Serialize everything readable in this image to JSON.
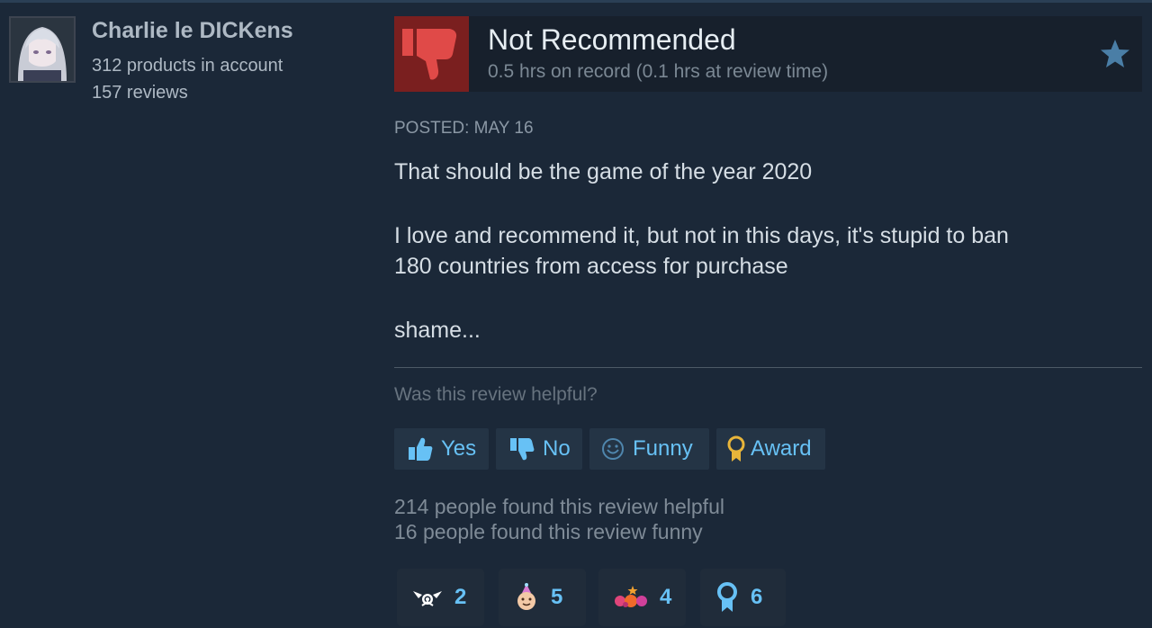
{
  "author": {
    "name": "Charlie le DICKens",
    "products": "312 products in account",
    "reviews": "157 reviews"
  },
  "review": {
    "verdict": "Not Recommended",
    "hours": "0.5 hrs on record (0.1 hrs at review time)",
    "posted": "POSTED: MAY 16",
    "paragraphs": [
      "That should be the game of the year 2020",
      "I love and recommend it, but not in this days, it's stupid to ban",
      "180 countries from access for purchase",
      "shame..."
    ]
  },
  "feedback": {
    "question": "Was this review helpful?",
    "buttons": {
      "yes": "Yes",
      "no": "No",
      "funny": "Funny",
      "award": "Award"
    },
    "helpful_count_text": "214 people found this review helpful",
    "funny_count_text": "16 people found this review funny"
  },
  "awards": [
    {
      "icon": "winged-award-icon",
      "count": "2"
    },
    {
      "icon": "party-face-award-icon",
      "count": "5"
    },
    {
      "icon": "confetti-award-icon",
      "count": "4"
    },
    {
      "icon": "ribbon-medal-award-icon",
      "count": "6"
    }
  ],
  "colors": {
    "background": "#1b2838",
    "accent_link": "#67c1f5",
    "not_recommended_bg": "#7a1f1f",
    "thumb_down": "#e04a48"
  }
}
